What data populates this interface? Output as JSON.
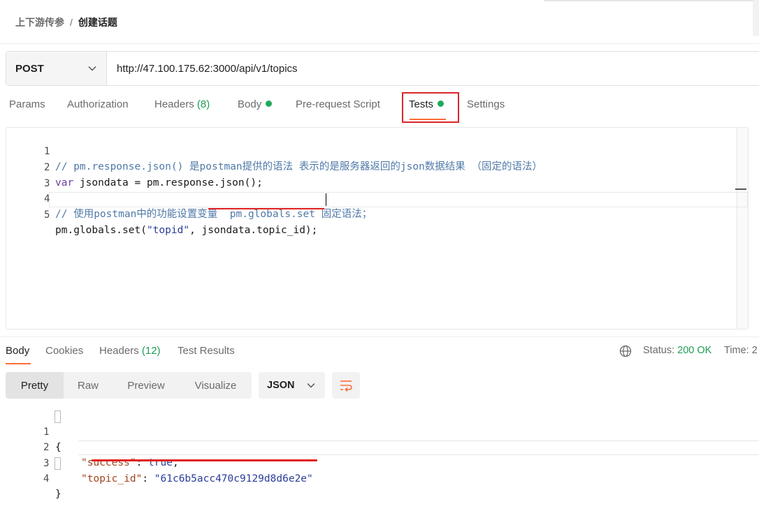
{
  "breadcrumb": {
    "parent": "上下游传参",
    "separator": "/",
    "current": "创建话题"
  },
  "request": {
    "method": "POST",
    "url": "http://47.100.175.62:3000/api/v1/topics"
  },
  "request_tabs": {
    "params": "Params",
    "authorization": "Authorization",
    "headers": "Headers",
    "headers_count": "(8)",
    "body": "Body",
    "prerequest": "Pre-request Script",
    "tests": "Tests",
    "settings": "Settings"
  },
  "editor": {
    "line_numbers": [
      "1",
      "2",
      "3",
      "4",
      "5"
    ],
    "line1": "// pm.response.json() 是postman提供的语法 表示的是服务器返回的json数据结果 （固定的语法）",
    "line2_kw": "var",
    "line2_rest": " jsondata = pm.response.json();",
    "line4": "// 使用postman中的功能设置变量  pm.globals.set 固定语法；",
    "line5_a": "pm.globals.set(",
    "line5_str": "\"topid\"",
    "line5_b": ", jsondata.topic_id);"
  },
  "response_tabs": {
    "body": "Body",
    "cookies": "Cookies",
    "headers": "Headers",
    "headers_count": "(12)",
    "test_results": "Test Results"
  },
  "status": {
    "label": "Status:",
    "value": "200 OK",
    "time_label": "Time:",
    "time_value": "2"
  },
  "view_modes": {
    "pretty": "Pretty",
    "raw": "Raw",
    "preview": "Preview",
    "visualize": "Visualize"
  },
  "format": "JSON",
  "response_body": {
    "line_numbers": [
      "1",
      "2",
      "3",
      "4"
    ],
    "open": "{",
    "success_key": "\"success\"",
    "success_value": "true",
    "topic_key": "\"topic_id\"",
    "topic_value": "\"61c6b5acc470c9129d8d6e2e\"",
    "close": "}"
  },
  "colors": {
    "accent": "#ff6c37",
    "success": "#1f9d55",
    "highlight": "#d9262a"
  }
}
